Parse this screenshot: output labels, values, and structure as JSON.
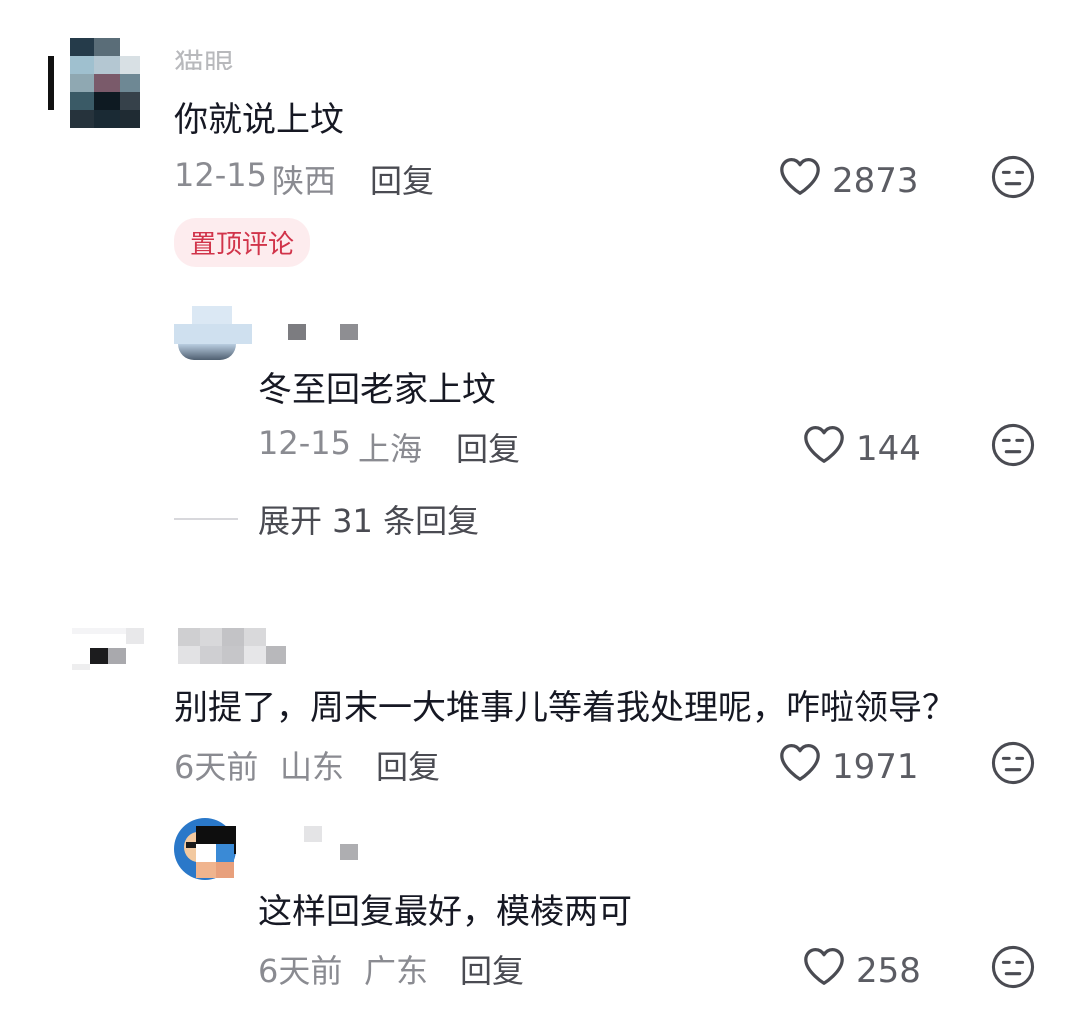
{
  "comments": [
    {
      "username": "猫眼",
      "content": "你就说上坟",
      "date": "12-15",
      "location": "陕西",
      "reply_label": "回复",
      "likes": "2873",
      "pinned_label": "置顶评论",
      "replies": [
        {
          "content": "冬至回老家上坟",
          "date": "12-15",
          "location": "上海",
          "reply_label": "回复",
          "likes": "144"
        }
      ],
      "expand_label": "展开 31 条回复"
    },
    {
      "content": "别提了，周末一大堆事儿等着我处理呢，咋啦领导？",
      "date": "6天前",
      "location": "山东",
      "reply_label": "回复",
      "likes": "1971",
      "replies": [
        {
          "content": "这样回复最好，模棱两可",
          "date": "6天前",
          "location": "广东",
          "reply_label": "回复",
          "likes": "258"
        }
      ]
    }
  ],
  "icons": {
    "like": "heart-outline-icon",
    "dislike": "neutral-face-icon"
  },
  "colors": {
    "text_primary": "#161823",
    "text_secondary": "#8a8b91",
    "pin_badge_bg": "#fdecee",
    "pin_badge_text": "#d1344a"
  }
}
